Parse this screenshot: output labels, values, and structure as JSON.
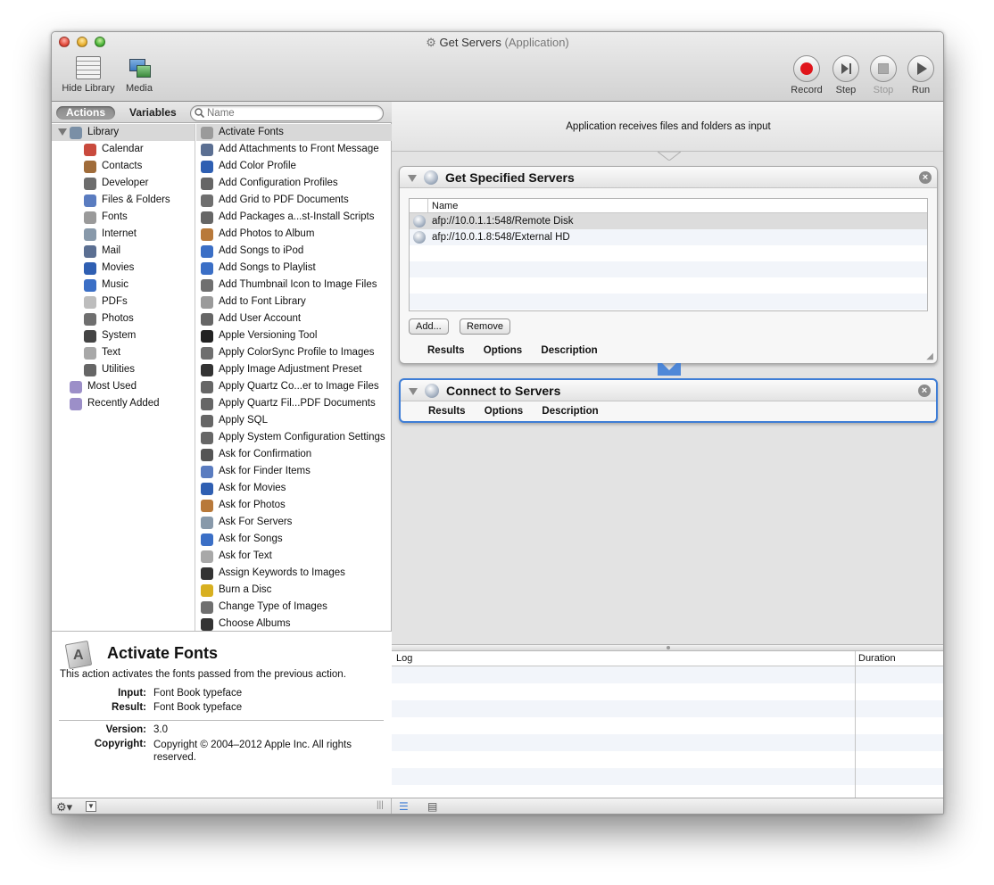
{
  "window": {
    "title": "Get Servers",
    "subtitle": "(Application)"
  },
  "toolbar": {
    "hide_library": "Hide Library",
    "media": "Media",
    "record": "Record",
    "step": "Step",
    "stop": "Stop",
    "run": "Run"
  },
  "library": {
    "seg_actions": "Actions",
    "seg_variables": "Variables",
    "search_placeholder": "Name",
    "categories": [
      {
        "label": "Library",
        "icon": "library-icon",
        "color": "#7a8fa6"
      },
      {
        "label": "Calendar",
        "icon": "calendar-icon",
        "color": "#c94a3d"
      },
      {
        "label": "Contacts",
        "icon": "contacts-icon",
        "color": "#a06c3a"
      },
      {
        "label": "Developer",
        "icon": "developer-icon",
        "color": "#6d6d6d"
      },
      {
        "label": "Files & Folders",
        "icon": "files-folders-icon",
        "color": "#5a7cc0"
      },
      {
        "label": "Fonts",
        "icon": "fonts-icon",
        "color": "#9a9a9a"
      },
      {
        "label": "Internet",
        "icon": "internet-icon",
        "color": "#8899aa"
      },
      {
        "label": "Mail",
        "icon": "mail-icon",
        "color": "#5b6f92"
      },
      {
        "label": "Movies",
        "icon": "movies-icon",
        "color": "#2f5fb2"
      },
      {
        "label": "Music",
        "icon": "music-icon",
        "color": "#3b6fc6"
      },
      {
        "label": "PDFs",
        "icon": "pdfs-icon",
        "color": "#bdbdbd"
      },
      {
        "label": "Photos",
        "icon": "photos-icon",
        "color": "#6f6f6f"
      },
      {
        "label": "System",
        "icon": "system-icon",
        "color": "#444444"
      },
      {
        "label": "Text",
        "icon": "text-icon",
        "color": "#a8a8a8"
      },
      {
        "label": "Utilities",
        "icon": "utilities-icon",
        "color": "#666666"
      },
      {
        "label": "Most Used",
        "icon": "most-used-icon",
        "color": "#9c8fc8"
      },
      {
        "label": "Recently Added",
        "icon": "recently-added-icon",
        "color": "#9c8fc8"
      }
    ],
    "actions": [
      {
        "label": "Activate Fonts",
        "icon": "fonts-icon",
        "color": "#9a9a9a"
      },
      {
        "label": "Add Attachments to Front Message",
        "icon": "mail-icon",
        "color": "#5b6f92"
      },
      {
        "label": "Add Color Profile",
        "icon": "color-profile-icon",
        "color": "#2f5fb2"
      },
      {
        "label": "Add Configuration Profiles",
        "icon": "config-icon",
        "color": "#666666"
      },
      {
        "label": "Add Grid to PDF Documents",
        "icon": "photos-icon",
        "color": "#6f6f6f"
      },
      {
        "label": "Add Packages a...st-Install Scripts",
        "icon": "config-icon",
        "color": "#666666"
      },
      {
        "label": "Add Photos to Album",
        "icon": "iphoto-icon",
        "color": "#b8793a"
      },
      {
        "label": "Add Songs to iPod",
        "icon": "music-icon",
        "color": "#3b6fc6"
      },
      {
        "label": "Add Songs to Playlist",
        "icon": "music-icon",
        "color": "#3b6fc6"
      },
      {
        "label": "Add Thumbnail Icon to Image Files",
        "icon": "photos-icon",
        "color": "#6f6f6f"
      },
      {
        "label": "Add to Font Library",
        "icon": "fonts-icon",
        "color": "#9a9a9a"
      },
      {
        "label": "Add User Account",
        "icon": "config-icon",
        "color": "#666666"
      },
      {
        "label": "Apple Versioning Tool",
        "icon": "terminal-icon",
        "color": "#222222"
      },
      {
        "label": "Apply ColorSync Profile to Images",
        "icon": "photos-icon",
        "color": "#6f6f6f"
      },
      {
        "label": "Apply Image Adjustment Preset",
        "icon": "aperture-icon",
        "color": "#333333"
      },
      {
        "label": "Apply Quartz Co...er to Image Files",
        "icon": "utilities-icon",
        "color": "#666666"
      },
      {
        "label": "Apply Quartz Fil...PDF Documents",
        "icon": "utilities-icon",
        "color": "#666666"
      },
      {
        "label": "Apply SQL",
        "icon": "utilities-icon",
        "color": "#666666"
      },
      {
        "label": "Apply System Configuration Settings",
        "icon": "config-icon",
        "color": "#666666"
      },
      {
        "label": "Ask for Confirmation",
        "icon": "confirm-icon",
        "color": "#555555"
      },
      {
        "label": "Ask for Finder Items",
        "icon": "finder-icon",
        "color": "#5a7cc0"
      },
      {
        "label": "Ask for Movies",
        "icon": "movies-icon",
        "color": "#2f5fb2"
      },
      {
        "label": "Ask for Photos",
        "icon": "iphoto-icon",
        "color": "#b8793a"
      },
      {
        "label": "Ask For Servers",
        "icon": "server-icon",
        "color": "#8899aa"
      },
      {
        "label": "Ask for Songs",
        "icon": "music-icon",
        "color": "#3b6fc6"
      },
      {
        "label": "Ask for Text",
        "icon": "text-icon",
        "color": "#a8a8a8"
      },
      {
        "label": "Assign Keywords to Images",
        "icon": "aperture-icon",
        "color": "#333333"
      },
      {
        "label": "Burn a Disc",
        "icon": "burn-icon",
        "color": "#d8b020"
      },
      {
        "label": "Change Type of Images",
        "icon": "photos-icon",
        "color": "#6f6f6f"
      },
      {
        "label": "Choose Albums",
        "icon": "aperture-icon",
        "color": "#333333"
      }
    ]
  },
  "description": {
    "title": "Activate Fonts",
    "text": "This action activates the fonts passed from the previous action.",
    "input_key": "Input:",
    "input_val": "Font Book typeface",
    "result_key": "Result:",
    "result_val": "Font Book typeface",
    "version_key": "Version:",
    "version_val": "3.0",
    "copyright_key": "Copyright:",
    "copyright_val": "Copyright © 2004–2012 Apple Inc. All rights reserved."
  },
  "workflow": {
    "receives": "Application receives files and folders as input",
    "action1": {
      "title": "Get Specified Servers",
      "col_name": "Name",
      "servers": [
        "afp://10.0.1.1:548/Remote Disk",
        "afp://10.0.1.8:548/External HD"
      ],
      "add_btn": "Add...",
      "remove_btn": "Remove",
      "tab_results": "Results",
      "tab_options": "Options",
      "tab_description": "Description"
    },
    "action2": {
      "title": "Connect to Servers",
      "tab_results": "Results",
      "tab_options": "Options",
      "tab_description": "Description"
    }
  },
  "log": {
    "col_log": "Log",
    "col_duration": "Duration"
  },
  "colors": {
    "selection_blue": "#3e7dd6",
    "record_red": "#e0141a"
  }
}
